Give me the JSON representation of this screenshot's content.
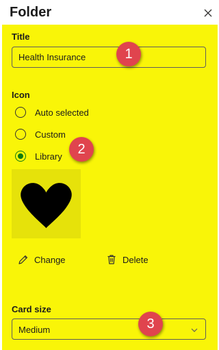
{
  "header": {
    "title": "Folder"
  },
  "fields": {
    "title_label": "Title",
    "title_value": "Health Insurance",
    "icon_label": "Icon",
    "radio_options": [
      "Auto selected",
      "Custom",
      "Library"
    ],
    "selected_option": "Library",
    "preview_icon": "heart-icon",
    "change_label": "Change",
    "delete_label": "Delete",
    "card_size_label": "Card size",
    "card_size_value": "Medium"
  },
  "annotations": [
    "1",
    "2",
    "3"
  ],
  "colors": {
    "panel_highlight": "#f9f508",
    "preview_bg": "#e6e20a",
    "radio_checked": "#107c10",
    "annotation_badge": "#e0444e"
  }
}
